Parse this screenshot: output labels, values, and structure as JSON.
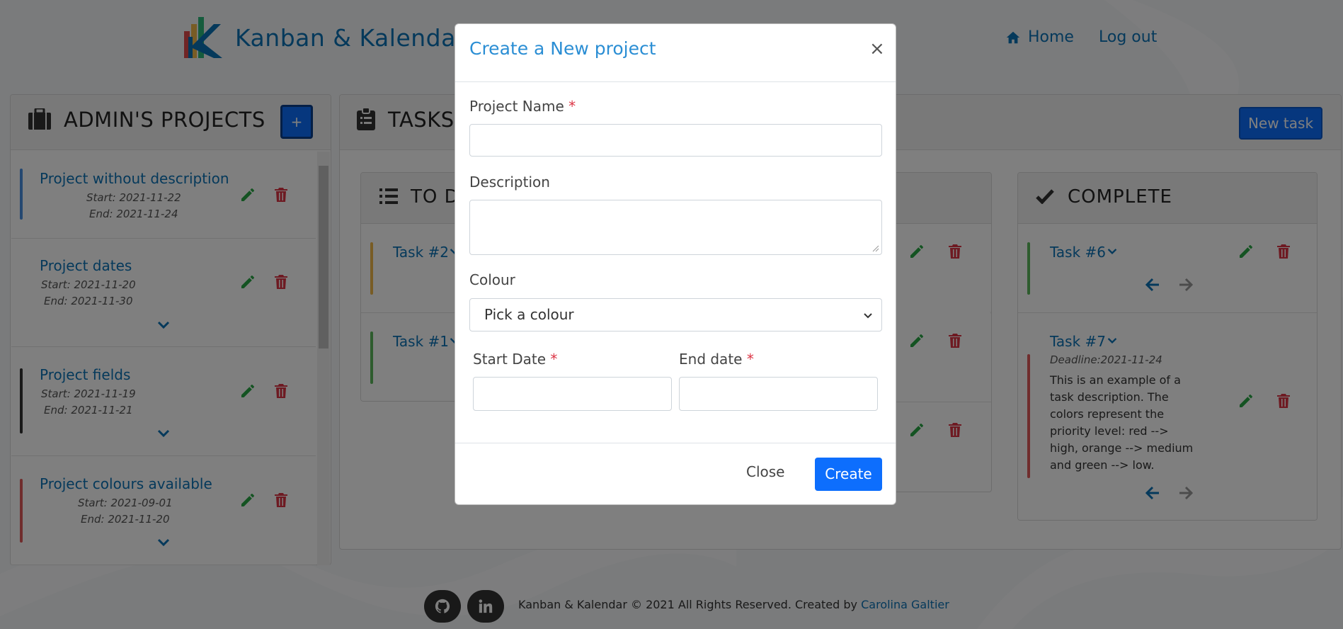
{
  "brand": {
    "name": "Kanban & Kalendar"
  },
  "nav": {
    "home": "Home",
    "logout": "Log out"
  },
  "projects": {
    "title": "ADMIN'S PROJECTS",
    "add_label": "+",
    "items": [
      {
        "name": "Project without description",
        "start": "Start: 2021-11-22",
        "end": "End: 2021-11-24",
        "color": "#4a90e2"
      },
      {
        "name": "Project dates",
        "start": "Start: 2021-11-20",
        "end": "End: 2021-11-30",
        "color": "#ffffff"
      },
      {
        "name": "Project fields",
        "start": "Start: 2021-11-19",
        "end": "End: 2021-11-21",
        "color": "#333333"
      },
      {
        "name": "Project colours available",
        "start": "Start: 2021-09-01",
        "end": "End: 2021-11-20",
        "color": "#e05a5a"
      }
    ]
  },
  "tasks_panel": {
    "title": "TASKS",
    "new_task_label": "New task",
    "columns": {
      "todo": {
        "title": "TO DO",
        "tasks": [
          {
            "name": "Task #2",
            "color": "#f0b94a"
          },
          {
            "name": "Task #1",
            "color": "#5cb85c"
          }
        ]
      },
      "complete": {
        "title": "COMPLETE",
        "tasks": [
          {
            "name": "Task #6",
            "color": "#5cb85c"
          },
          {
            "name": "Task #7",
            "deadline": "Deadline:2021-11-24",
            "description": "This is an example of a task description. The colors represent the priority level: red --> high, orange --> medium and green --> low.",
            "color": "#e05a5a"
          }
        ]
      }
    }
  },
  "footer": {
    "text": "Kanban & Kalendar © 2021 All Rights Reserved. Created by ",
    "author": "Carolina Galtier"
  },
  "modal": {
    "title": "Create a New project",
    "close_x": "×",
    "project_name_label": "Project Name",
    "required_mark": "*",
    "description_label": "Description",
    "colour_label": "Colour",
    "colour_selected": "Pick a colour",
    "start_date_label": "Start Date",
    "end_date_label": "End date",
    "close_button": "Close",
    "create_button": "Create"
  },
  "colors": {
    "accent": "#0d6efd",
    "brand": "#0b73b6",
    "edit": "#28a745",
    "delete": "#dc3545"
  }
}
